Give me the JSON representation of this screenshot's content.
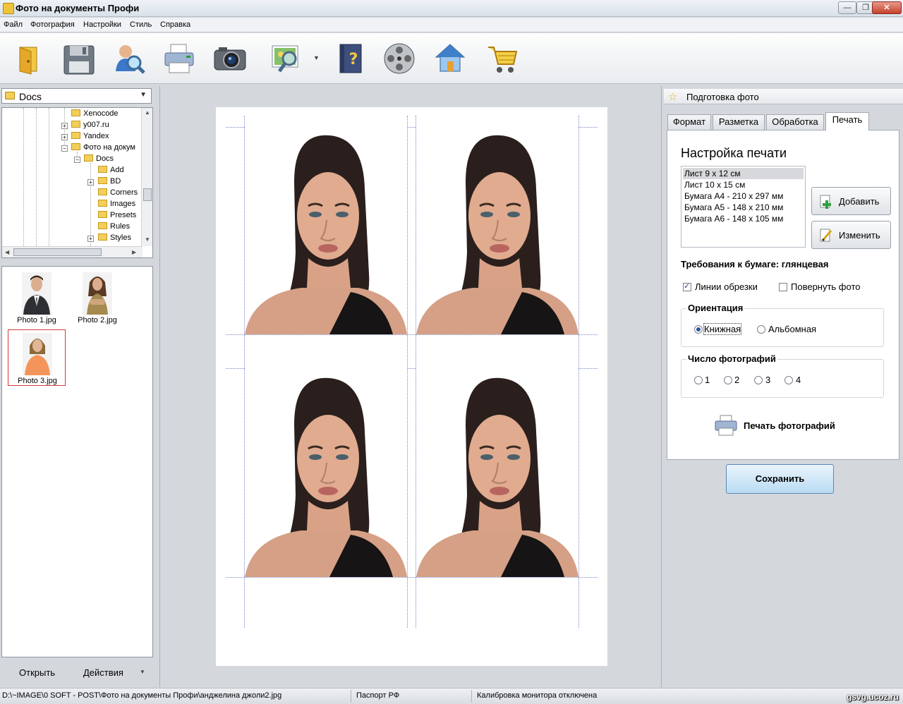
{
  "window": {
    "title": "Фото на документы Профи"
  },
  "menu": [
    "Файл",
    "Фотография",
    "Настройки",
    "Стиль",
    "Справка"
  ],
  "toolbar": {
    "icons": [
      "open-icon",
      "save-icon",
      "user-search-icon",
      "print-icon",
      "camera-icon",
      "image-zoom-icon",
      "help-book-icon",
      "film-reel-icon",
      "home-icon",
      "shopping-cart-icon"
    ]
  },
  "left": {
    "folder_combo": "Docs",
    "tree": [
      "Xenocode",
      "y007.ru",
      "Yandex",
      "Фото на докум",
      "Docs",
      "Add",
      "BD",
      "Corners",
      "Images",
      "Presets",
      "Rules",
      "Styles"
    ],
    "thumbs": [
      "Photo 1.jpg",
      "Photo 2.jpg",
      "Photo 3.jpg"
    ],
    "open_label": "Открыть",
    "actions_label": "Действия"
  },
  "right": {
    "header": "Подготовка фото",
    "tabs": [
      "Формат",
      "Разметка",
      "Обработка",
      "Печать"
    ],
    "active_tab": "Печать",
    "section_title": "Настройка печати",
    "paper_sizes": [
      "Лист 9 х 12 см",
      "Лист 10 х 15 см",
      "Бумага А4 - 210 х 297 мм",
      "Бумага А5 - 148 х 210 мм",
      "Бумага А6 - 148 х 105 мм"
    ],
    "selected_paper": "Лист 9 х 12 см",
    "add_label": "Добавить",
    "edit_label": "Изменить",
    "paper_req": "Требования к бумаге: глянцевая",
    "crop_lines_label": "Линии обрезки",
    "crop_lines_checked": true,
    "rotate_label": "Повернуть фото",
    "rotate_checked": false,
    "orientation_title": "Ориентация",
    "orientation_options": [
      "Книжная",
      "Альбомная"
    ],
    "orientation_selected": "Книжная",
    "count_title": "Число фотографий",
    "count_options": [
      "1",
      "2",
      "3",
      "4"
    ],
    "print_label": "Печать фотографий",
    "save_label": "Сохранить"
  },
  "status": {
    "path": "D:\\~IMAGE\\0 SOFT - POST\\Фото на документы Профи\\анджелина джоли2.jpg",
    "format": "Паспорт РФ",
    "calibration": "Калибровка монитора отключена"
  },
  "watermark": "gsvg.ucoz.ru"
}
